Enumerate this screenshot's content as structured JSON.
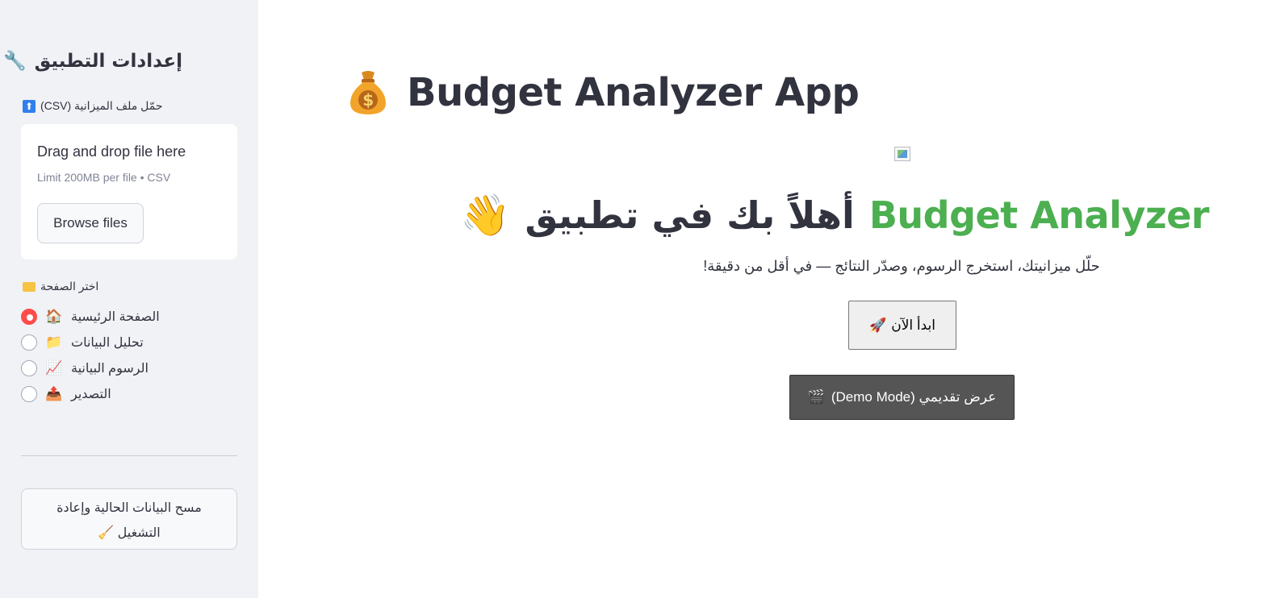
{
  "sidebar": {
    "title": "إعدادات التطبيق",
    "title_icon": "🔧",
    "upload_label": "حمّل ملف الميزانية (CSV)",
    "upload_icon": "⬆",
    "dropzone": {
      "title": "Drag and drop file here",
      "limit": "Limit 200MB per file • CSV",
      "browse_label": "Browse files"
    },
    "radio_label": "اختر الصفحة",
    "radio_options": [
      {
        "label": "الصفحة الرئيسية",
        "icon": "🏠",
        "selected": true
      },
      {
        "label": "تحليل البيانات",
        "icon": "📁",
        "selected": false
      },
      {
        "label": "الرسوم البيانية",
        "icon": "📈",
        "selected": false
      },
      {
        "label": "التصدير",
        "icon": "📤",
        "selected": false
      }
    ],
    "reset_button": "مسح البيانات الحالية وإعادة التشغيل",
    "reset_icon": "🧹"
  },
  "main": {
    "title": "Budget Analyzer App",
    "title_icon": "💰",
    "welcome_green": "Budget Analyzer",
    "welcome_ar": "أهلاً بك في تطبيق",
    "welcome_icon": "👋",
    "subtitle": "حلّل ميزانيتك، استخرج الرسوم، وصدّر النتائج — في أقل من دقيقة!",
    "start_button": "ابدأ الآن",
    "start_icon": "🚀",
    "demo_button": "عرض تقديمي (Demo Mode)",
    "demo_icon": "🎬"
  },
  "colors": {
    "sidebar_bg": "#f0f2f6",
    "accent_red": "#ff4b4b",
    "green": "#4caf50",
    "text": "#31333f",
    "demo_bg": "#555555"
  }
}
